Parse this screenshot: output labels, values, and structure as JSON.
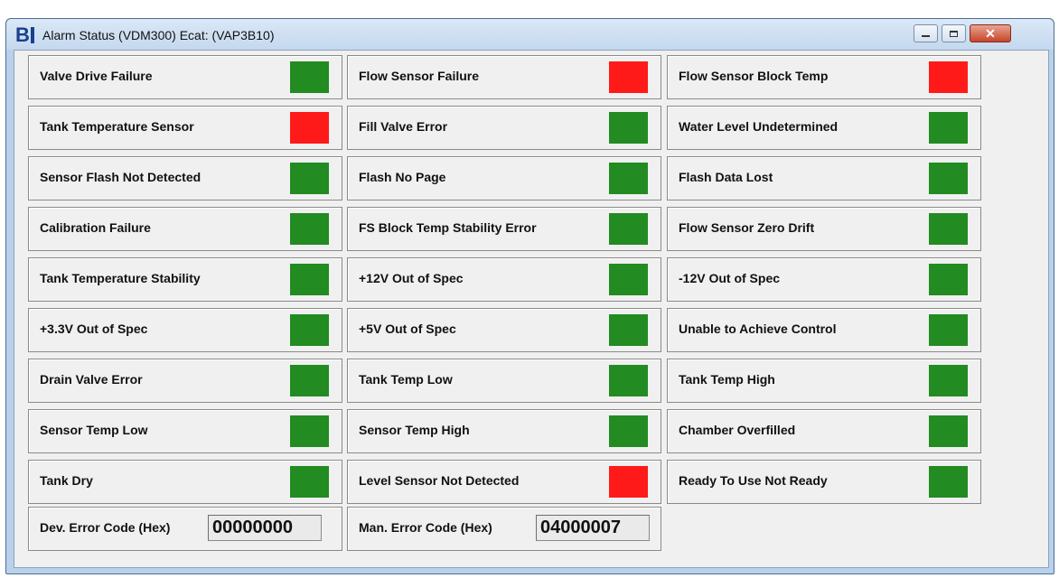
{
  "window": {
    "title": "Alarm Status (VDM300) Ecat: (VAP3B10)",
    "icon_text": "B",
    "controls": {
      "close_glyph": "✕"
    }
  },
  "colors": {
    "ok": "#228b22",
    "alarm": "#ff1a1a"
  },
  "alarms": [
    [
      {
        "label": "Valve Drive Failure",
        "status": "ok"
      },
      {
        "label": "Tank Temperature Sensor",
        "status": "alarm"
      },
      {
        "label": "Sensor Flash Not Detected",
        "status": "ok"
      },
      {
        "label": "Calibration Failure",
        "status": "ok"
      },
      {
        "label": "Tank Temperature Stability",
        "status": "ok"
      },
      {
        "label": "+3.3V Out of Spec",
        "status": "ok"
      },
      {
        "label": "Drain Valve Error",
        "status": "ok"
      },
      {
        "label": "Sensor Temp Low",
        "status": "ok"
      },
      {
        "label": "Tank Dry",
        "status": "ok"
      }
    ],
    [
      {
        "label": "Flow Sensor Failure",
        "status": "alarm"
      },
      {
        "label": "Fill Valve Error",
        "status": "ok"
      },
      {
        "label": "Flash No Page",
        "status": "ok"
      },
      {
        "label": "FS Block Temp Stability Error",
        "status": "ok"
      },
      {
        "label": "+12V Out of Spec",
        "status": "ok"
      },
      {
        "label": "+5V Out of Spec",
        "status": "ok"
      },
      {
        "label": "Tank Temp Low",
        "status": "ok"
      },
      {
        "label": "Sensor Temp High",
        "status": "ok"
      },
      {
        "label": "Level Sensor Not Detected",
        "status": "alarm"
      }
    ],
    [
      {
        "label": "Flow Sensor Block Temp",
        "status": "alarm"
      },
      {
        "label": "Water Level Undetermined",
        "status": "ok"
      },
      {
        "label": "Flash Data Lost",
        "status": "ok"
      },
      {
        "label": "Flow Sensor Zero Drift",
        "status": "ok"
      },
      {
        "label": "-12V Out of Spec",
        "status": "ok"
      },
      {
        "label": "Unable to Achieve Control",
        "status": "ok"
      },
      {
        "label": "Tank Temp High",
        "status": "ok"
      },
      {
        "label": "Chamber Overfilled",
        "status": "ok"
      },
      {
        "label": "Ready To Use Not Ready",
        "status": "ok"
      }
    ]
  ],
  "error_codes": {
    "device": {
      "label": "Dev. Error Code (Hex)",
      "value": "00000000"
    },
    "manufacturer": {
      "label": "Man. Error Code (Hex)",
      "value": "04000007"
    }
  }
}
